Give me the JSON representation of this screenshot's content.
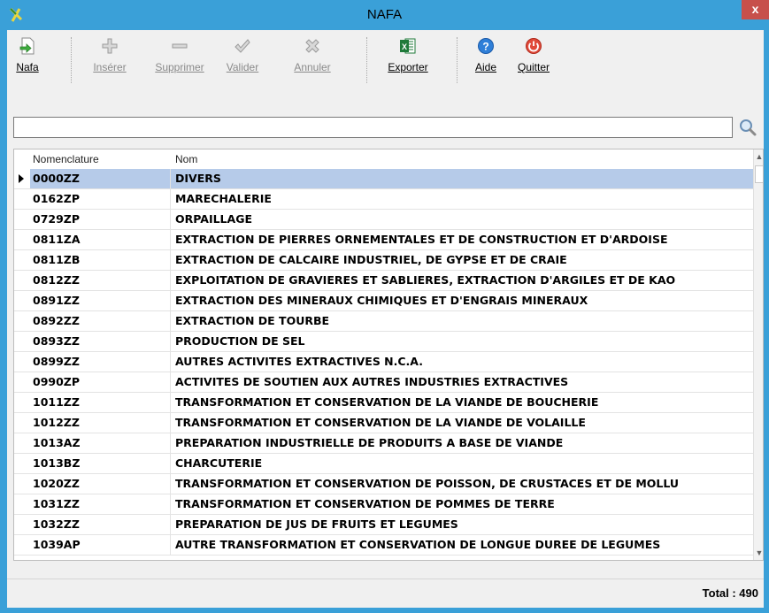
{
  "window": {
    "title": "NAFA",
    "close_label": "x"
  },
  "toolbar": {
    "nafa": "Nafa",
    "inserer": "Insérer",
    "supprimer": "Supprimer",
    "valider": "Valider",
    "annuler": "Annuler",
    "exporter": "Exporter",
    "aide": "Aide",
    "quitter": "Quitter"
  },
  "search": {
    "value": ""
  },
  "grid": {
    "columns": [
      "Nomenclature",
      "Nom"
    ],
    "selected_index": 0,
    "rows": [
      {
        "code": "0000ZZ",
        "name": "DIVERS"
      },
      {
        "code": "0162ZP",
        "name": "MARECHALERIE"
      },
      {
        "code": "0729ZP",
        "name": "ORPAILLAGE"
      },
      {
        "code": "0811ZA",
        "name": "EXTRACTION DE PIERRES ORNEMENTALES ET DE CONSTRUCTION ET D'ARDOISE"
      },
      {
        "code": "0811ZB",
        "name": "EXTRACTION DE CALCAIRE INDUSTRIEL, DE GYPSE ET DE CRAIE"
      },
      {
        "code": "0812ZZ",
        "name": "EXPLOITATION DE GRAVIERES ET SABLIERES, EXTRACTION D'ARGILES ET DE KAO"
      },
      {
        "code": "0891ZZ",
        "name": "EXTRACTION DES MINERAUX CHIMIQUES ET D'ENGRAIS MINERAUX"
      },
      {
        "code": "0892ZZ",
        "name": "EXTRACTION DE TOURBE"
      },
      {
        "code": "0893ZZ",
        "name": "PRODUCTION DE SEL"
      },
      {
        "code": "0899ZZ",
        "name": "AUTRES ACTIVITES EXTRACTIVES N.C.A."
      },
      {
        "code": "0990ZP",
        "name": "ACTIVITES DE SOUTIEN AUX AUTRES INDUSTRIES EXTRACTIVES"
      },
      {
        "code": "1011ZZ",
        "name": "TRANSFORMATION ET CONSERVATION DE LA VIANDE DE BOUCHERIE"
      },
      {
        "code": "1012ZZ",
        "name": "TRANSFORMATION ET CONSERVATION DE LA VIANDE DE VOLAILLE"
      },
      {
        "code": "1013AZ",
        "name": "PREPARATION INDUSTRIELLE DE PRODUITS A BASE DE VIANDE"
      },
      {
        "code": "1013BZ",
        "name": "CHARCUTERIE"
      },
      {
        "code": "1020ZZ",
        "name": "TRANSFORMATION ET CONSERVATION DE POISSON, DE CRUSTACES ET DE MOLLU"
      },
      {
        "code": "1031ZZ",
        "name": "TRANSFORMATION ET CONSERVATION DE POMMES DE TERRE"
      },
      {
        "code": "1032ZZ",
        "name": "PREPARATION DE JUS DE FRUITS ET LEGUMES"
      },
      {
        "code": "1039AP",
        "name": "AUTRE TRANSFORMATION ET CONSERVATION DE LONGUE DUREE DE LEGUMES"
      }
    ]
  },
  "status": {
    "total": "Total : 490"
  },
  "icons": {
    "app": "scissors-icon",
    "nafa": "document-arrow-icon",
    "inserer": "plus-icon",
    "supprimer": "minus-icon",
    "valider": "check-icon",
    "annuler": "x-icon",
    "exporter": "excel-icon",
    "aide": "help-icon",
    "quitter": "power-icon",
    "search": "magnifier-icon"
  },
  "colors": {
    "titlebar": "#3aa0d8",
    "selection": "#b6cbe9",
    "close": "#c7504b"
  }
}
